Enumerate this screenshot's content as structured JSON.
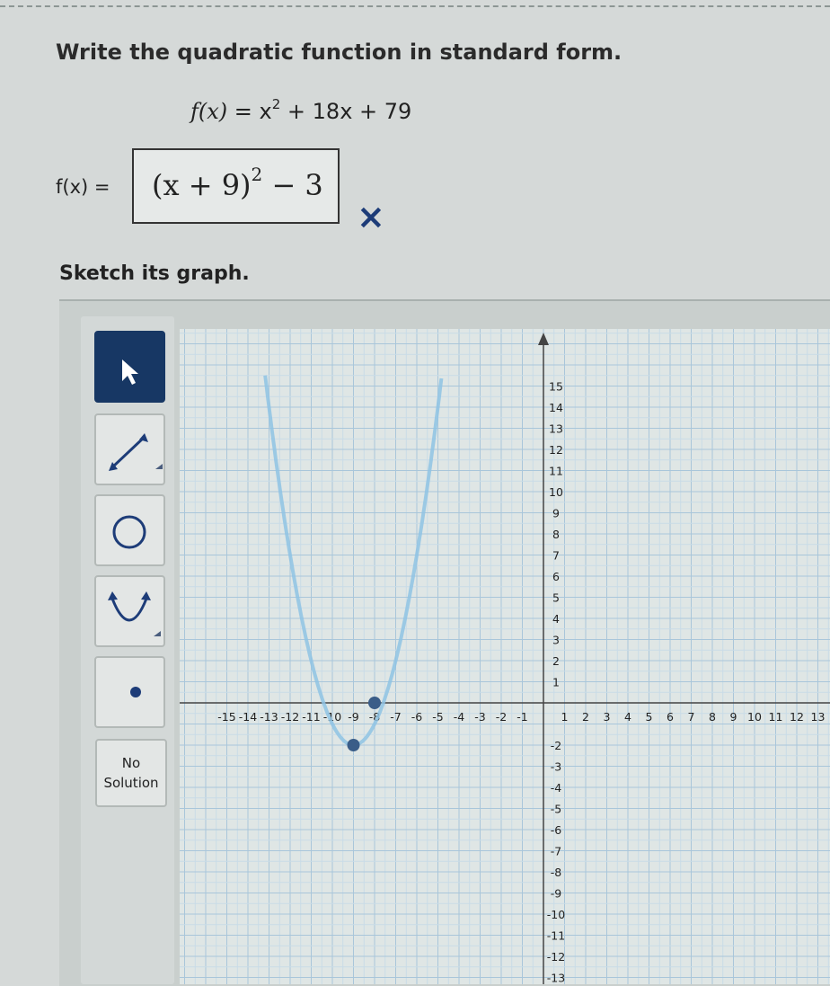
{
  "question": {
    "prompt": "Write the quadratic function in standard form.",
    "func_name": "f(x)",
    "func_rhs": "= x2 + 18x + 79",
    "answer_label": "f(x) =",
    "answer_base": "(x + 9)",
    "answer_exponent": "2",
    "answer_tail": "− 3",
    "result_mark": "×",
    "sketch_prompt": "Sketch its graph."
  },
  "tools": {
    "items": [
      "arrow-select",
      "line",
      "circle",
      "parabola",
      "point"
    ],
    "active": "arrow-select",
    "no_solution_line1": "No",
    "no_solution_line2": "Solution"
  },
  "colors": {
    "active_tool": "#173764",
    "parabola": "#8fc3e4",
    "point": "#3a5d88",
    "wrong_mark": "#1d3c78"
  },
  "chart_data": {
    "type": "line",
    "x_ticks": [
      "-15",
      "-14",
      "-13",
      "-12",
      "-11",
      "-10",
      "-9",
      "-8",
      "-7",
      "-6",
      "-5",
      "-4",
      "-3",
      "-2",
      "-1",
      "1",
      "2",
      "3",
      "4",
      "5",
      "6",
      "7",
      "8",
      "9",
      "10",
      "11",
      "12",
      "13"
    ],
    "y_ticks": [
      "15",
      "14",
      "13",
      "12",
      "11",
      "10",
      "9",
      "8",
      "7",
      "6",
      "5",
      "4",
      "3",
      "2",
      "1",
      "-2",
      "-3",
      "-4",
      "-5",
      "-6",
      "-7",
      "-8",
      "-9",
      "-10",
      "-11",
      "-12",
      "-13"
    ],
    "xlim": [
      -16.5,
      14
    ],
    "ylim": [
      -14,
      15.5
    ],
    "grid": true,
    "series": [
      {
        "kind": "parabola",
        "vertex": [
          -9,
          -2
        ],
        "through": [
          -8,
          -1
        ],
        "points": [
          [
            -12.5,
            15
          ],
          [
            -11,
            5
          ],
          [
            -10,
            0
          ],
          [
            -9,
            -2
          ],
          [
            -8,
            0
          ],
          [
            -7,
            5
          ],
          [
            -5.5,
            15
          ]
        ]
      }
    ],
    "points": [
      {
        "x": -9,
        "y": -2
      },
      {
        "x": -8,
        "y": 0
      }
    ]
  }
}
